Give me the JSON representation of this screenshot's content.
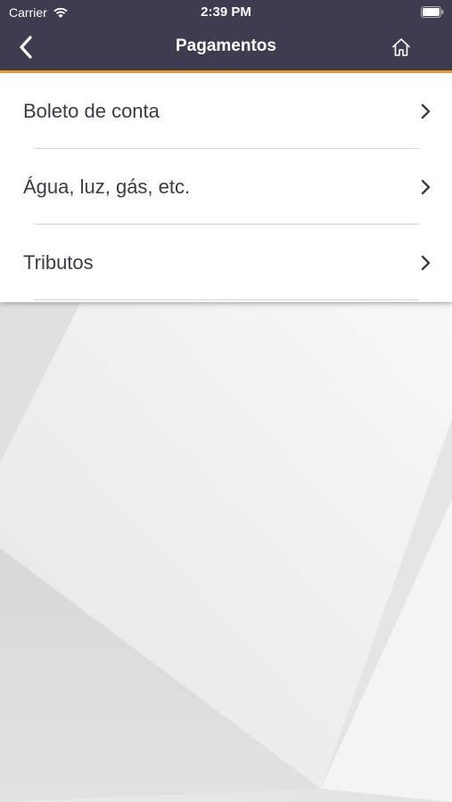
{
  "status_bar": {
    "carrier": "Carrier",
    "time": "2:39 PM",
    "icons": [
      "wifi-icon",
      "battery-icon"
    ]
  },
  "nav": {
    "title": "Pagamentos",
    "back_icon": "chevron-left-icon",
    "home_icon": "home-icon"
  },
  "colors": {
    "nav_background": "#3c3d4f",
    "accent": "#f39c33",
    "menu_text": "#3a3b45"
  },
  "menu": {
    "items": [
      {
        "label": "Boleto de conta",
        "icon": "chevron-right-icon"
      },
      {
        "label": "Água, luz, gás, etc.",
        "icon": "chevron-right-icon"
      },
      {
        "label": "Tributos",
        "icon": "chevron-right-icon"
      }
    ]
  }
}
